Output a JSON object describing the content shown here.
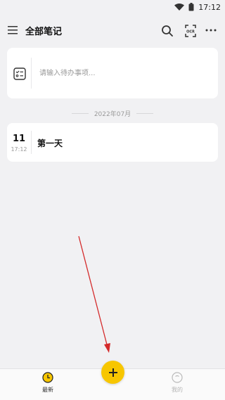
{
  "status_bar": {
    "time": "17:12"
  },
  "header": {
    "title": "全部笔记"
  },
  "todo": {
    "placeholder": "请输入待办事项..."
  },
  "month_separator": {
    "label": "2022年07月"
  },
  "notes": [
    {
      "day": "11",
      "time": "17:12",
      "title": "第一天"
    }
  ],
  "bottom_nav": {
    "items": [
      {
        "label": "最新",
        "icon": "clock-icon",
        "active": true
      },
      {
        "label": "我的",
        "icon": "profile-icon",
        "active": false
      }
    ],
    "fab_icon": "plus-icon"
  },
  "colors": {
    "accent": "#f7c600",
    "background": "#f1f1f3",
    "card": "#ffffff",
    "annotation_arrow": "#d42a2a"
  }
}
